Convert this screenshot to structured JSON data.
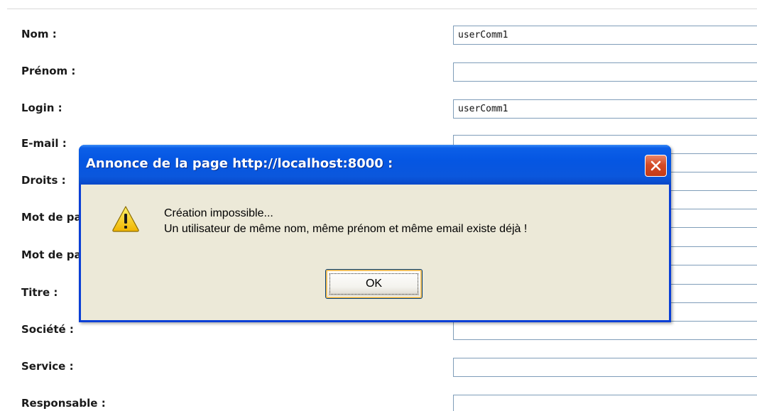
{
  "form": {
    "fields": [
      {
        "label": "Nom :",
        "value": "userComm1"
      },
      {
        "label": "Prénom :",
        "value": ""
      },
      {
        "label": "Login :",
        "value": "userComm1"
      },
      {
        "label": "E-mail :",
        "value": ""
      },
      {
        "label": "Droits :",
        "value": ""
      },
      {
        "label": "Mot de passe :",
        "value": ""
      },
      {
        "label": "Mot de passe :",
        "value": ""
      },
      {
        "label": "Titre :",
        "value": ""
      },
      {
        "label": "Société :",
        "value": ""
      },
      {
        "label": "Service :",
        "value": ""
      },
      {
        "label": "Responsable :",
        "value": ""
      }
    ]
  },
  "dialog": {
    "title": "Annonce de la page http://localhost:8000 :",
    "message_line1": "Création impossible...",
    "message_line2": "Un utilisateur de même nom, même prénom et même email existe déjà !",
    "ok_label": "OK",
    "icon": "warning-icon",
    "close_icon": "close-icon"
  },
  "colors": {
    "titlebar": "#0556e2",
    "dialog_bg": "#ece9d8",
    "close_button": "#d44b26",
    "warning": "#f7d21a"
  }
}
